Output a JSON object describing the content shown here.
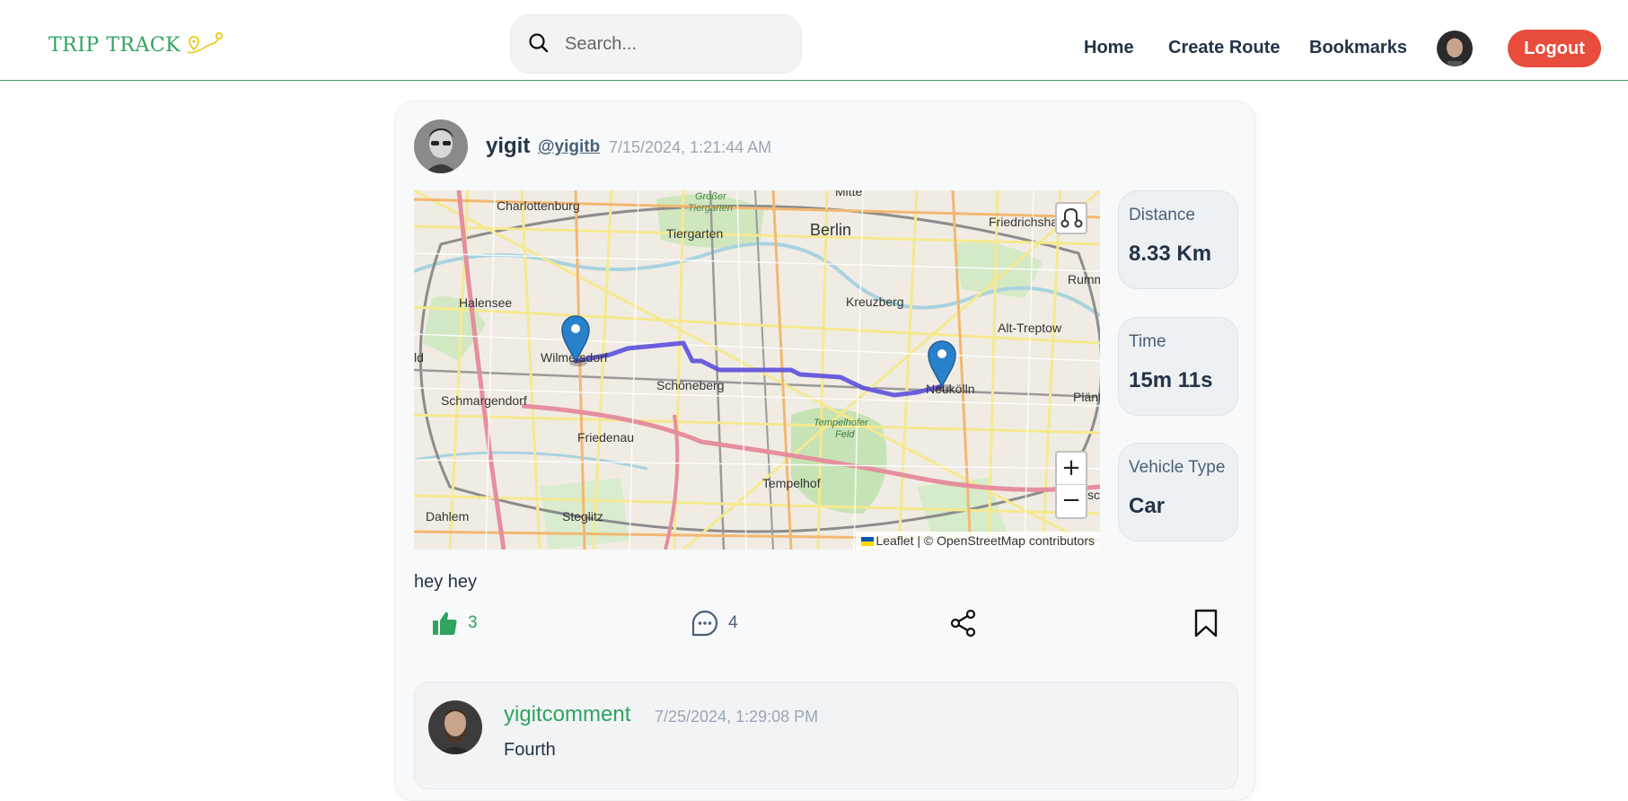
{
  "header": {
    "logo_text": "TRIP TRACK",
    "search_placeholder": "Search...",
    "nav": {
      "home": "Home",
      "create_route": "Create Route",
      "bookmarks": "Bookmarks"
    },
    "logout_label": "Logout"
  },
  "post": {
    "username": "yigit",
    "handle": "@yigitb",
    "timestamp": "7/15/2024, 1:21:44 AM",
    "description": "hey hey",
    "map": {
      "labels": [
        "Charlottenburg",
        "Großer",
        "Tiergarten",
        "Tiergarten",
        "Mitte",
        "Berlin",
        "Friedrichshain",
        "Rumm",
        "Halensee",
        "Kreuzberg",
        "Alt-Treptow",
        "Wilmersdorf",
        "ld",
        "Schöneberg",
        "Neukölln",
        "Schmargendorf",
        "Plänter",
        "Tempelhofer",
        "Feld",
        "Friedenau",
        "Tempelhof",
        "Dahlem",
        "Steglitz",
        "sch"
      ],
      "attribution": {
        "leaflet": "Leaflet",
        "separator": " | © ",
        "osm": "OpenStreetMap contributors"
      },
      "zoom_in": "+",
      "zoom_out": "−"
    },
    "stats": [
      {
        "label": "Distance",
        "value": "8.33 Km"
      },
      {
        "label": "Time",
        "value": "15m 11s"
      },
      {
        "label": "Vehicle Type",
        "value": "Car"
      }
    ],
    "actions": {
      "likes": "3",
      "comments": "4"
    },
    "colors": {
      "brand": "#2fa35f",
      "logout": "#e74c3c",
      "route": "#5b4fdb",
      "marker": "#2a81cb"
    }
  },
  "comment": {
    "username": "yigitcomment",
    "timestamp": "7/25/2024, 1:29:08 PM",
    "text": "Fourth"
  },
  "icons": [
    "route-pin-icon",
    "search-icon",
    "thumbs-up-icon",
    "comment-icon",
    "share-icon",
    "bookmark-icon",
    "route-toggle-icon",
    "map-marker-icon"
  ]
}
